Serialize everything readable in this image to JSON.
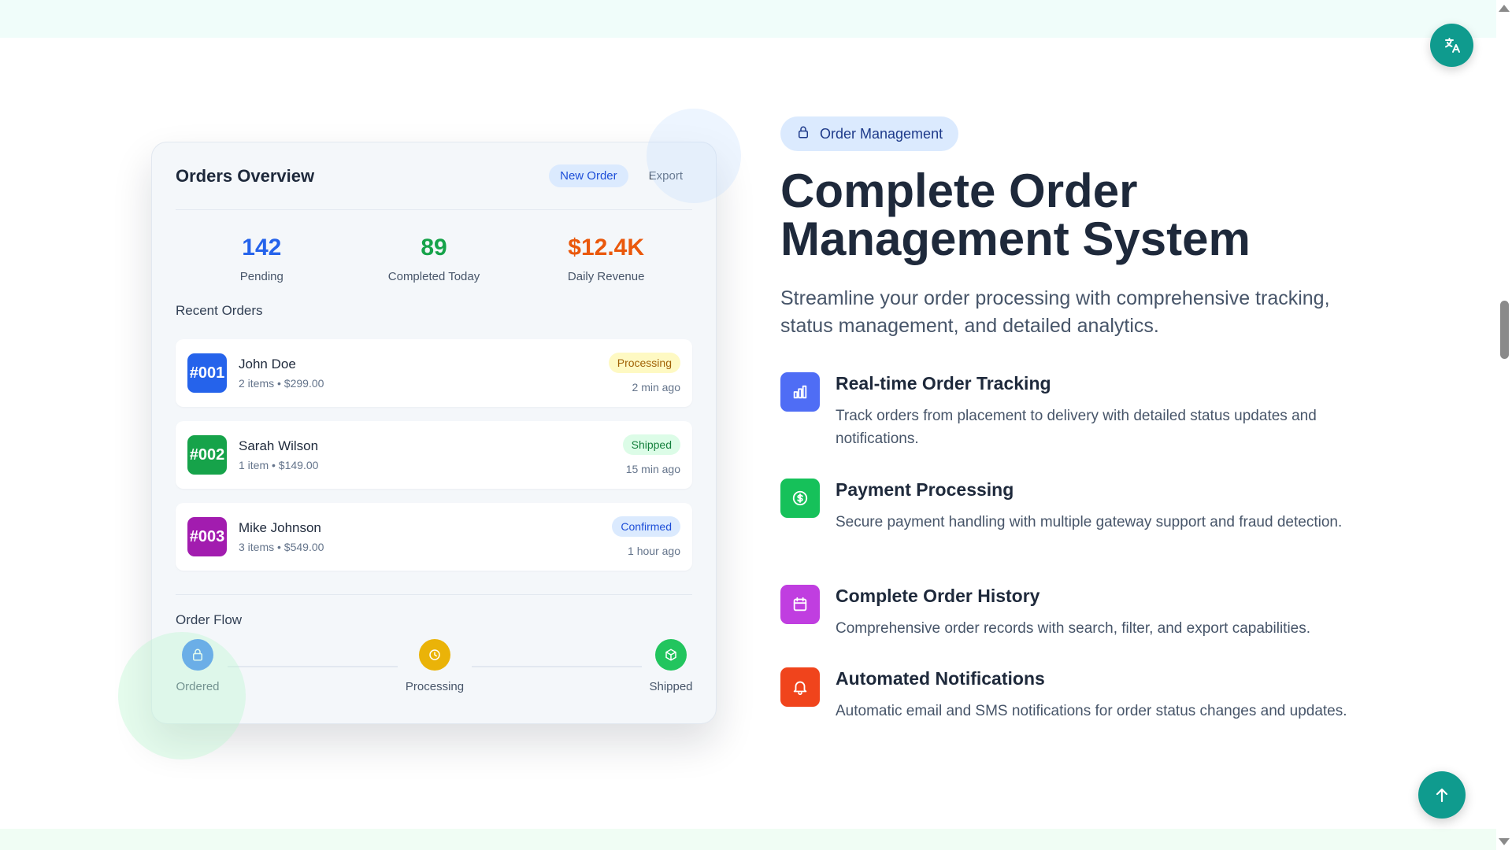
{
  "card": {
    "title": "Orders Overview",
    "new_order_label": "New Order",
    "export_label": "Export",
    "stats": [
      {
        "value": "142",
        "label": "Pending",
        "color": "#2563eb"
      },
      {
        "value": "89",
        "label": "Completed Today",
        "color": "#16a34a"
      },
      {
        "value": "$12.4K",
        "label": "Daily Revenue",
        "color": "#ea580c"
      }
    ],
    "recent_label": "Recent Orders",
    "orders": [
      {
        "id": "#001",
        "name": "John Doe",
        "meta": "2 items • $299.00",
        "status": "Processing",
        "time": "2 min ago",
        "id_color": "#2563eb",
        "status_bg": "#fef9c3",
        "status_color": "#a16207"
      },
      {
        "id": "#002",
        "name": "Sarah Wilson",
        "meta": "1 item • $149.00",
        "status": "Shipped",
        "time": "15 min ago",
        "id_color": "#16a34a",
        "status_bg": "#dcfce7",
        "status_color": "#15803d"
      },
      {
        "id": "#003",
        "name": "Mike Johnson",
        "meta": "3 items • $549.00",
        "status": "Confirmed",
        "time": "1 hour ago",
        "id_color": "#a21caf",
        "status_bg": "#dbeafe",
        "status_color": "#1d4ed8"
      }
    ],
    "flow_label": "Order Flow",
    "flow": [
      {
        "label": "Ordered",
        "icon": "bag-icon",
        "color": "#3b82f6"
      },
      {
        "label": "Processing",
        "icon": "clock-icon",
        "color": "#eab308"
      },
      {
        "label": "Shipped",
        "icon": "box-icon",
        "color": "#22c55e"
      }
    ]
  },
  "hero": {
    "pill_label": "Order Management",
    "pill_icon": "bag-icon",
    "title_line1": "Complete Order",
    "title_line2": "Management System",
    "subtitle": "Streamline your order processing with comprehensive tracking, status management, and detailed analytics."
  },
  "features": [
    {
      "title": "Real-time Order Tracking",
      "desc": "Track orders from placement to delivery with detailed status updates and notifications.",
      "icon": "bar-chart-icon",
      "color": "#4f6df5"
    },
    {
      "title": "Payment Processing",
      "desc": "Secure payment handling with multiple gateway support and fraud detection.",
      "icon": "dollar-circle-icon",
      "color": "#16c15a"
    },
    {
      "title": "Complete Order History",
      "desc": "Comprehensive order records with search, filter, and export capabilities.",
      "icon": "calendar-icon",
      "color": "#c03ee0"
    },
    {
      "title": "Automated Notifications",
      "desc": "Automatic email and SMS notifications for order status changes and updates.",
      "icon": "bell-icon",
      "color": "#f0441c"
    }
  ],
  "floating": {
    "translate_icon": "translate-icon",
    "top_icon": "arrow-up-icon",
    "accent": "#0f9b8e"
  }
}
